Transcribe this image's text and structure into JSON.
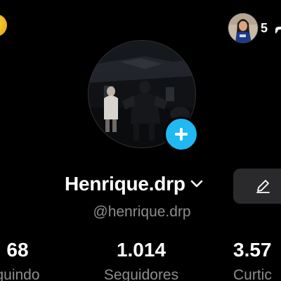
{
  "profile": {
    "username": "Henrique.drp",
    "handle": "@henrique.drp"
  },
  "header": {
    "friends_count": "5"
  },
  "stats": [
    {
      "value": "68",
      "label": "guindo"
    },
    {
      "value": "1.014",
      "label": "Seguidores"
    },
    {
      "value": "3.57",
      "label": "Curtic"
    }
  ],
  "colors": {
    "background": "#000000",
    "accent": "#20b9f3",
    "muted_text": "#8d8d90",
    "button_bg": "#2a2a2c"
  },
  "icons": {
    "add": "plus-icon",
    "username_dropdown": "chevron-down-icon",
    "edit": "pencil-icon"
  }
}
